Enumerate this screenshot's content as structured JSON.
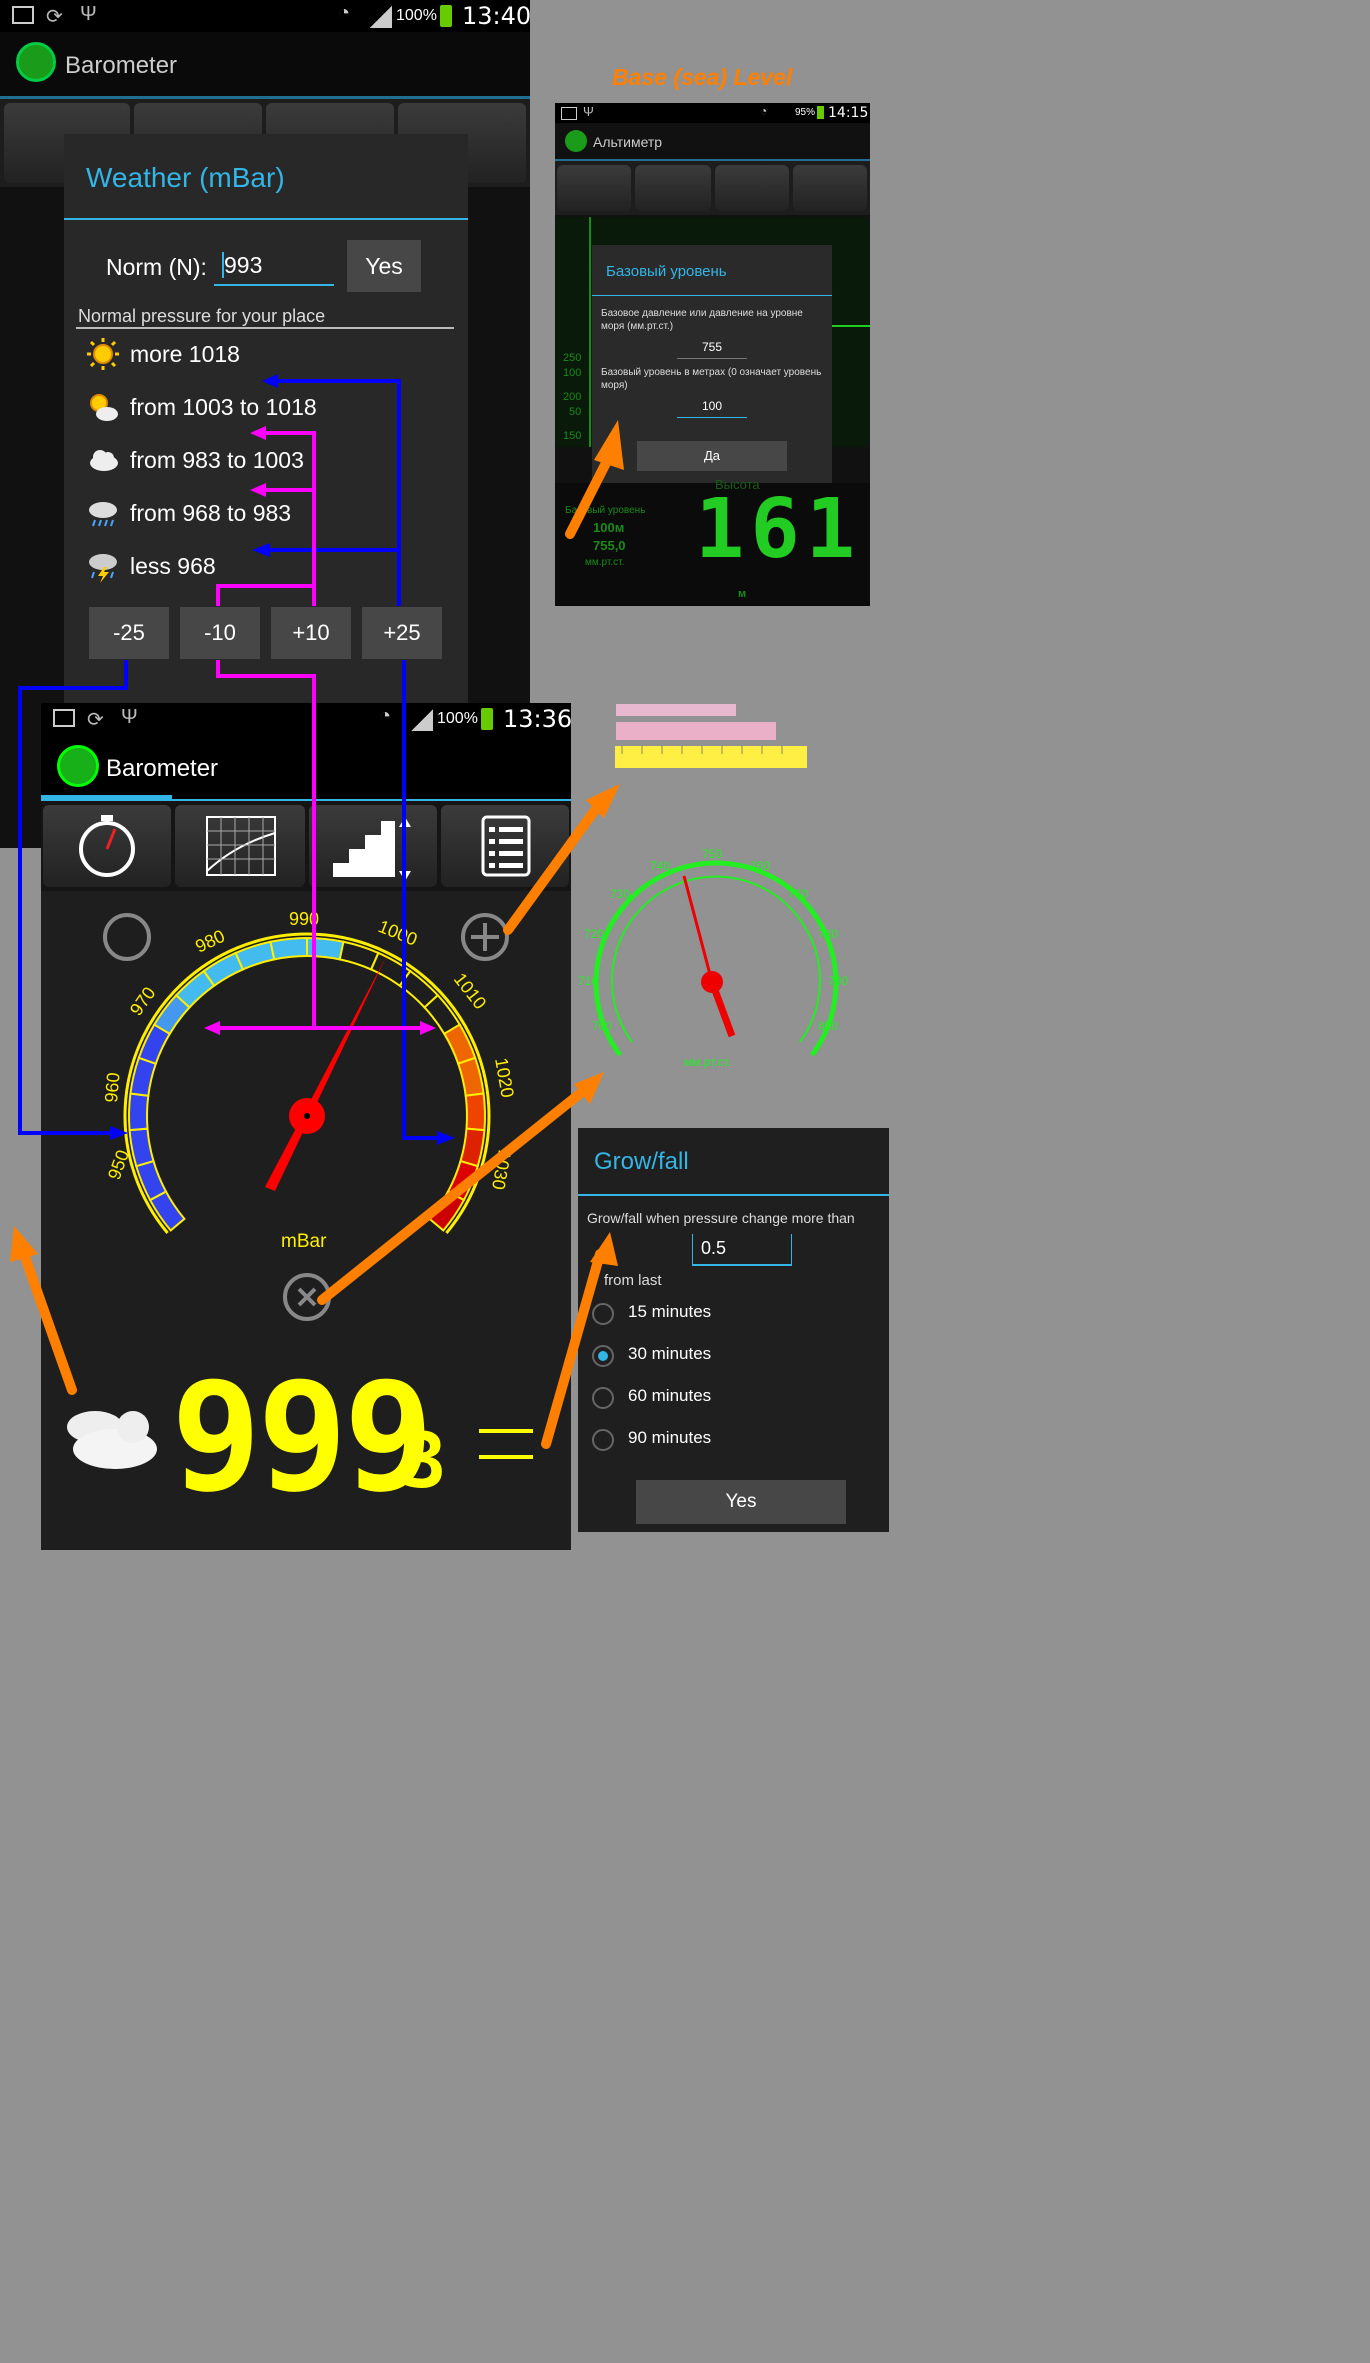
{
  "back_phone": {
    "status_battery": "100%",
    "status_time": "13:40",
    "app_title": "Barometer",
    "weather_dialog": {
      "title": "Weather (mBar)",
      "norm_label": "Norm (N):",
      "norm_value": "993",
      "yes_button": "Yes",
      "hint": "Normal pressure for your place",
      "rows": [
        {
          "icon": "sun-icon",
          "label": "more 1018"
        },
        {
          "icon": "sun-cloud-icon",
          "label": "from 1003 to 1018"
        },
        {
          "icon": "cloud-icon",
          "label": "from 983 to 1003"
        },
        {
          "icon": "rain-cloud-icon",
          "label": "from 968 to 983"
        },
        {
          "icon": "storm-cloud-icon",
          "label": "less 968"
        }
      ],
      "adjust_buttons": [
        "-25",
        "-10",
        "+10",
        "+25"
      ]
    }
  },
  "altimeter": {
    "caption": "Base (sea) Level",
    "status_battery": "95%",
    "status_time": "14:15",
    "app_title": "Альтиметр",
    "axis_ticks": [
      "250",
      "200",
      "150",
      "100",
      "50"
    ],
    "dialog": {
      "title": "Базовый уровень",
      "label1": "Базовое давление или давление на уровне моря (мм.рт.ст.)",
      "value1": "755",
      "label2": "Базовый уровень в метрах (0 означает уровень моря)",
      "value2": "100",
      "button": "Да"
    },
    "bottom": {
      "header": "Высота",
      "base_label": "Базовый уровень",
      "base_m": "100м",
      "base_p": "755,0",
      "base_unit": "мм.рт.ст.",
      "big_value": "161",
      "unit": "м"
    }
  },
  "front_phone": {
    "status_battery": "100%",
    "status_time": "13:36",
    "app_title": "Barometer",
    "gauge": {
      "ticks": [
        "950",
        "960",
        "970",
        "980",
        "990",
        "1000",
        "1010",
        "1020",
        "1030"
      ],
      "unit": "mBar",
      "needle_value": 1000
    },
    "display_value": "999",
    "display_decimal": "3"
  },
  "side_gauge": {
    "ticks": [
      "700",
      "710",
      "720",
      "730",
      "740",
      "750",
      "760",
      "770",
      "780",
      "790",
      "800"
    ],
    "unit": "мм.рт.ст."
  },
  "growfall": {
    "title": "Grow/fall",
    "label": "Grow/fall when pressure change more than",
    "value": "0.5",
    "from_last": "from last",
    "options": [
      {
        "label": "15 minutes",
        "selected": false
      },
      {
        "label": "30 minutes",
        "selected": true
      },
      {
        "label": "60 minutes",
        "selected": false
      },
      {
        "label": "90 minutes",
        "selected": false
      }
    ],
    "button": "Yes"
  },
  "colors": {
    "accent": "#33b5e5",
    "yellow": "#ffff00",
    "arrow": "#ff8000",
    "blue_line": "#0000ff",
    "magenta_line": "#ff00ff",
    "needle": "#ff0000",
    "green": "#22ee22"
  }
}
